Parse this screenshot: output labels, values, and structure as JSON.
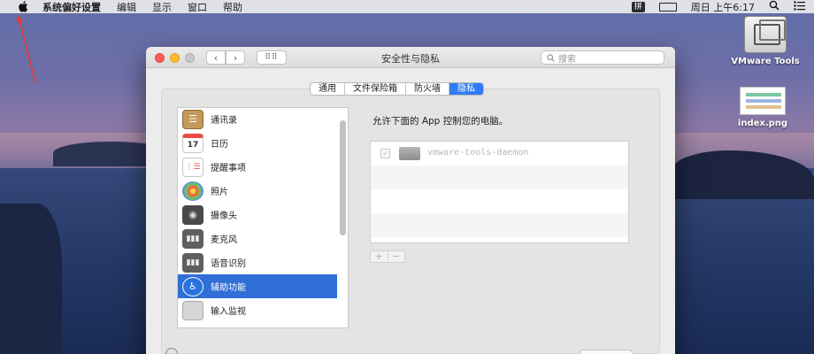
{
  "menubar": {
    "apple": "",
    "app_name": "系统偏好设置",
    "items": [
      "编辑",
      "显示",
      "窗口",
      "帮助"
    ],
    "ime": "拼",
    "clock": "周日 上午6:17"
  },
  "desktop": {
    "icons": [
      {
        "label": "VMware Tools"
      },
      {
        "label": "index.png"
      }
    ]
  },
  "window": {
    "title": "安全性与隐私",
    "back": "‹",
    "forward": "›",
    "grid": "⠿⠿",
    "search_placeholder": "搜索",
    "tabs": [
      {
        "label": "通用",
        "active": false
      },
      {
        "label": "文件保险箱",
        "active": false
      },
      {
        "label": "防火墙",
        "active": false
      },
      {
        "label": "隐私",
        "active": true
      }
    ],
    "privacy_list": [
      {
        "label": "通讯录",
        "icon": "contacts-icon"
      },
      {
        "label": "日历",
        "icon": "calendar-icon",
        "glyph": "17"
      },
      {
        "label": "提醒事项",
        "icon": "reminders-icon"
      },
      {
        "label": "照片",
        "icon": "photos-icon"
      },
      {
        "label": "摄像头",
        "icon": "camera-icon"
      },
      {
        "label": "麦克风",
        "icon": "microphone-icon"
      },
      {
        "label": "语音识别",
        "icon": "speech-icon"
      },
      {
        "label": "辅助功能",
        "icon": "accessibility-icon",
        "selected": true
      },
      {
        "label": "输入监视",
        "icon": "keyboard-icon"
      }
    ],
    "right_heading": "允许下面的 App 控制您的电脑。",
    "apps": [
      {
        "name": "vmware-tools-daemon",
        "checked": true
      }
    ],
    "add": "+",
    "remove": "−"
  }
}
